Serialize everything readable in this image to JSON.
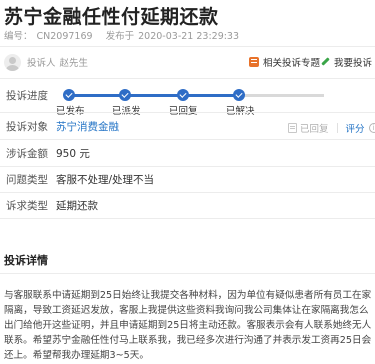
{
  "page": {
    "title": "苏宁金融任性付延期还款"
  },
  "meta": {
    "id_label": "编号：",
    "id_value": "CN2097169",
    "published_label": "发布于",
    "published_value": "2020-03-21 23:29:33"
  },
  "complainant": {
    "label": "投诉人",
    "name": "赵先生"
  },
  "actions": {
    "related": "相关投诉专题",
    "want": "我要投诉"
  },
  "progress": {
    "label": "投诉进度",
    "steps": [
      {
        "label": "已发布"
      },
      {
        "label": "已派发"
      },
      {
        "label": "已回复"
      },
      {
        "label": "已解决"
      }
    ]
  },
  "target": {
    "label": "投诉对象",
    "value": "苏宁消费金融",
    "sent_label": "已回复",
    "rate_label": "评分",
    "info_glyph": "i"
  },
  "amount": {
    "label": "涉诉金额",
    "value": "950 元"
  },
  "issue": {
    "label": "问题类型",
    "value": "客服不处理/处理不当"
  },
  "demand": {
    "label": "诉求类型",
    "value": "延期还款"
  },
  "details": {
    "title": "投诉详情",
    "text": "与客服联系中请延期到25日始终让我提交各种材料，因为单位有疑似患者所有员工在家隔离，导致工资延迟发放，客服上我提供这些资料我询问我公司集体让在家隔离我怎么出门给他开这些证明，并且申请延期到25日将主动还款。客服表示会有人联系她终无人联系。希望苏宁金融任性付马上联系我，我已经多次进行沟通了并表示发工资再25日会还上。希望帮我办理延期3~5天。"
  },
  "colors": {
    "accent_blue": "#2f6dc6",
    "link_blue": "#2474c6",
    "orange": "#e8722a",
    "green": "#3aa548"
  },
  "icons": [
    "avatar-icon",
    "related-topic-icon",
    "pen-icon",
    "check-icon",
    "document-icon",
    "info-icon"
  ]
}
